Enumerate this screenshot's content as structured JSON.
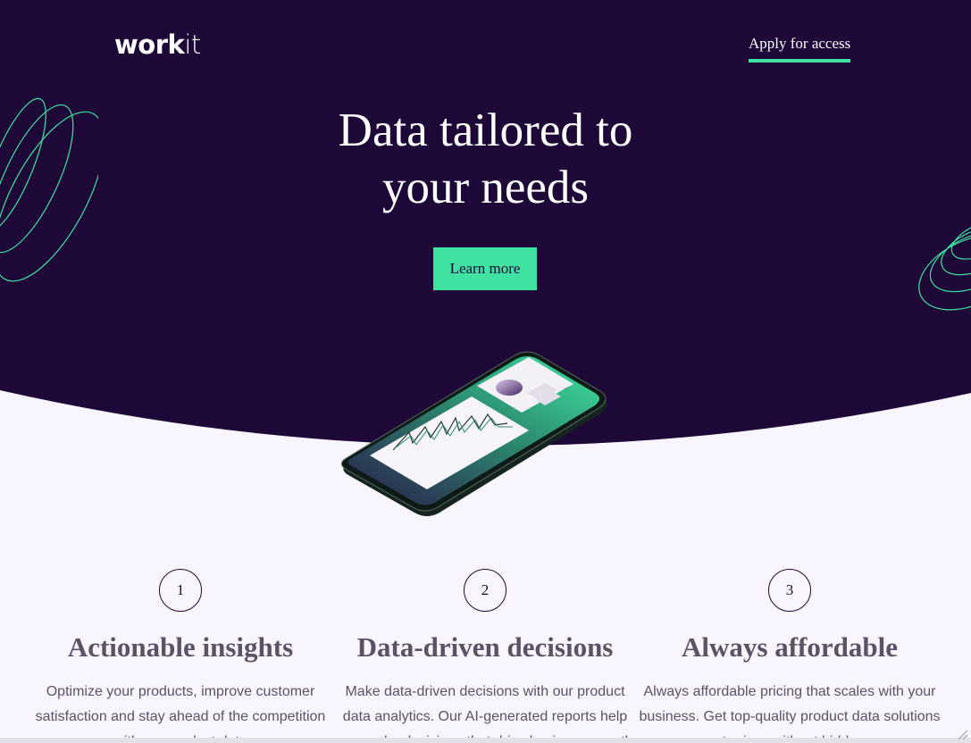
{
  "header": {
    "logo_bold": "work",
    "logo_light": "it",
    "nav_link": "Apply for access"
  },
  "hero": {
    "title_line1": "Data tailored to",
    "title_line2": "your needs",
    "cta_label": "Learn more"
  },
  "features": [
    {
      "number": "1",
      "title": "Actionable insights",
      "text": "Optimize your products, improve customer satisfaction and stay ahead of the competition with our product data"
    },
    {
      "number": "2",
      "title": "Data-driven decisions",
      "text": "Make data-driven decisions with our product data analytics. Our AI-generated reports help you make decisions that drive business growth"
    },
    {
      "number": "3",
      "title": "Always affordable",
      "text": "Always affordable pricing that scales with your business. Get top-quality product data solutions at prices without hidden"
    }
  ],
  "colors": {
    "hero_bg": "#1e0838",
    "accent": "#3fe2a0",
    "page_bg": "#f8f5fe",
    "text": "#5c5267"
  }
}
